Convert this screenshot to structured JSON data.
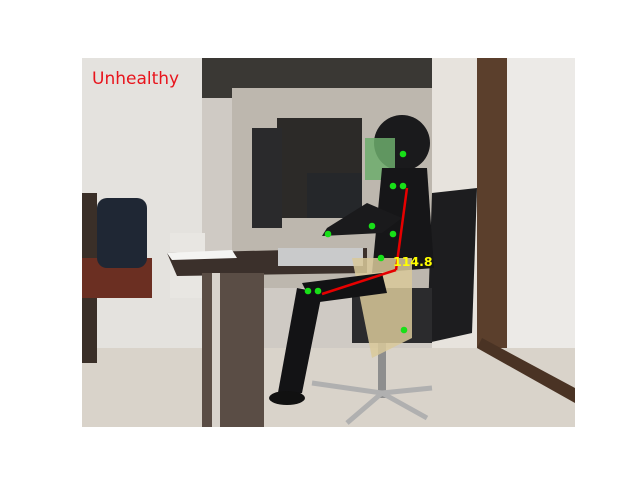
{
  "status": {
    "label": "Unhealthy",
    "color": "#e8141c"
  },
  "posture": {
    "angle_label": "114.8",
    "angle_color": "#ffff00",
    "line_color": "#e60000",
    "keypoint_color": "#18e018"
  },
  "scene": {
    "description_icons": [
      "office-room",
      "desk",
      "monitor",
      "laptop",
      "office-chair",
      "seated-person",
      "backpack",
      "door"
    ]
  }
}
